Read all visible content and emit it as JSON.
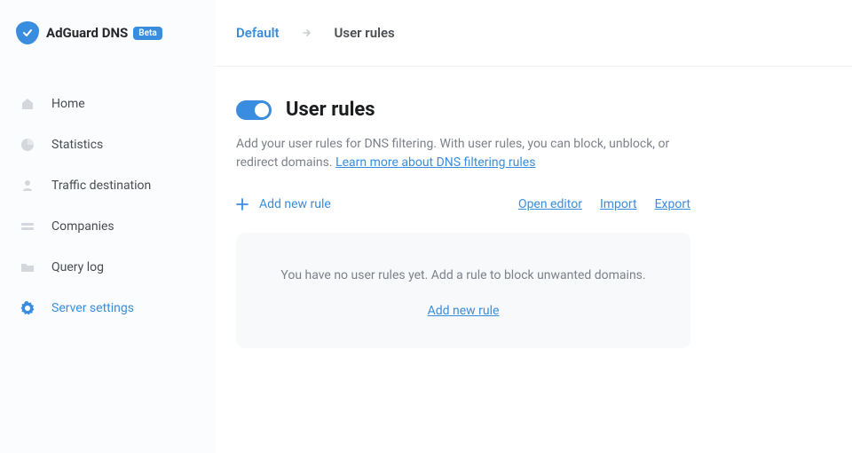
{
  "brand": {
    "name": "AdGuard DNS",
    "badge": "Beta"
  },
  "sidebar": {
    "items": [
      {
        "label": "Home"
      },
      {
        "label": "Statistics"
      },
      {
        "label": "Traffic destination"
      },
      {
        "label": "Companies"
      },
      {
        "label": "Query log"
      },
      {
        "label": "Server settings"
      }
    ]
  },
  "breadcrumb": {
    "root": "Default",
    "current": "User rules"
  },
  "page": {
    "title": "User rules",
    "toggle_on": true,
    "description": "Add your user rules for DNS filtering. With user rules, you can block, unblock, or redirect domains. ",
    "learn_more": "Learn more about DNS filtering rules"
  },
  "actions": {
    "add": "Add new rule",
    "open_editor": "Open editor",
    "import": "Import",
    "export": "Export"
  },
  "empty": {
    "text": "You have no user rules yet. Add a rule to block unwanted domains.",
    "link": "Add new rule"
  }
}
